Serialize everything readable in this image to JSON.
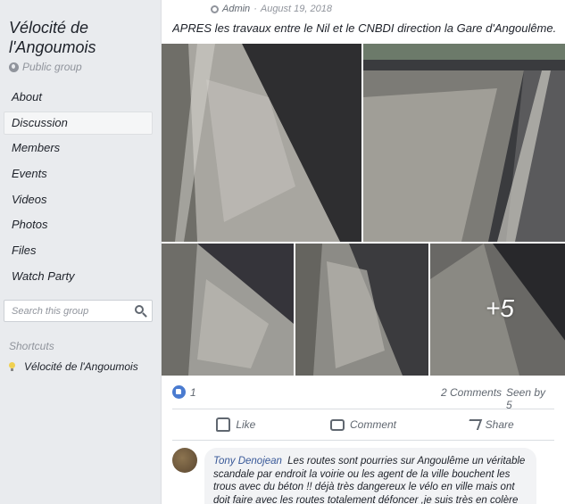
{
  "sidebar": {
    "group_name": "Vélocité de l'Angoumois",
    "privacy": "Public group",
    "items": [
      {
        "label": "About",
        "active": false
      },
      {
        "label": "Discussion",
        "active": true
      },
      {
        "label": "Members",
        "active": false
      },
      {
        "label": "Events",
        "active": false
      },
      {
        "label": "Videos",
        "active": false
      },
      {
        "label": "Photos",
        "active": false
      },
      {
        "label": "Files",
        "active": false
      },
      {
        "label": "Watch Party",
        "active": false
      }
    ],
    "search_placeholder": "Search this group",
    "shortcuts_title": "Shortcuts",
    "shortcuts": [
      {
        "label": "Vélocité de l'Angoumois"
      }
    ]
  },
  "post": {
    "author_role": "Admin",
    "date": "August 19, 2018",
    "meta_separator": " · ",
    "text": "APRES les travaux entre le Nil et le CNBDI direction la Gare d'Angoulême...",
    "more_photos": "+5",
    "like_count": "1",
    "comments_count": "2 Comments",
    "seen_by": "Seen by 5",
    "actions": {
      "like": "Like",
      "comment": "Comment",
      "share": "Share"
    }
  },
  "comment": {
    "author": "Tony Denojean",
    "text": "Les routes sont pourries sur Angoulême un véritable scandale par endroit la voirie ou les agent de la ville bouchent les trous avec du béton !! déjà très dangereux le vélo en ville mais ont doit faire avec les routes totalement défoncer ,je suis très en colère"
  },
  "colors": {
    "background": "#e9ebee",
    "link": "#385898",
    "like_blue": "#4a7bd0"
  }
}
